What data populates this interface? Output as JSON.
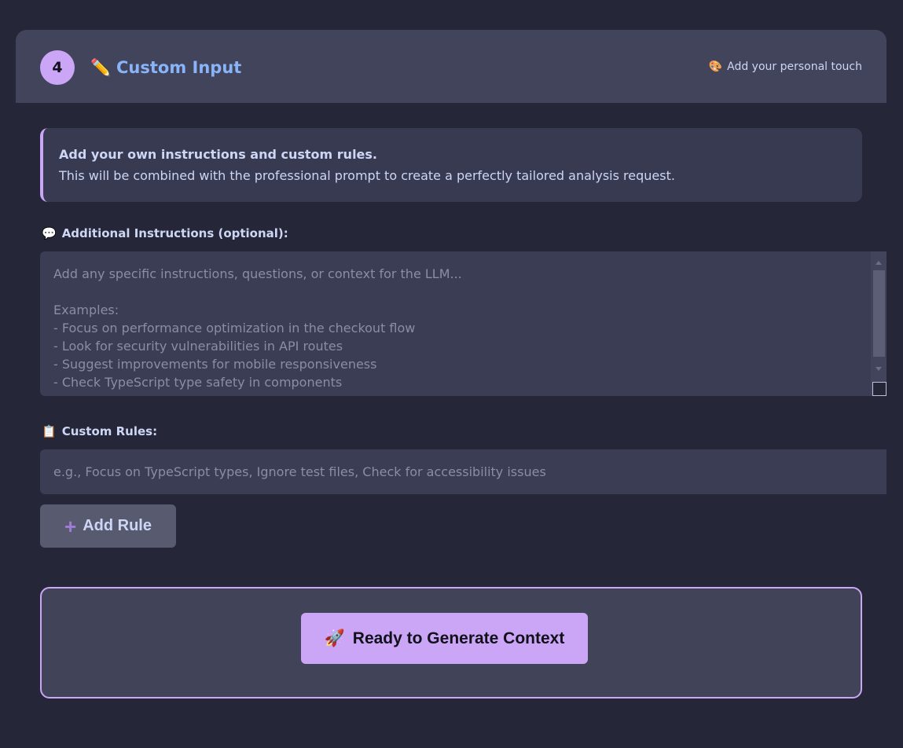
{
  "step": {
    "number": "4",
    "title_icon": "✏️",
    "title": "Custom Input",
    "hint_icon": "🎨",
    "hint": "Add your personal touch"
  },
  "info": {
    "strong": "Add your own instructions and custom rules.",
    "text": "This will be combined with the professional prompt to create a perfectly tailored analysis request."
  },
  "instructions": {
    "icon": "💬",
    "label": "Additional Instructions (optional):",
    "placeholder": "Add any specific instructions, questions, or context for the LLM...\n\nExamples:\n- Focus on performance optimization in the checkout flow\n- Look for security vulnerabilities in API routes\n- Suggest improvements for mobile responsiveness\n- Check TypeScript type safety in components",
    "value": ""
  },
  "rules": {
    "icon": "📋",
    "label": "Custom Rules:",
    "placeholder": "e.g., Focus on TypeScript types, Ignore test files, Check for accessibility issues",
    "value": "",
    "add_icon": "+",
    "add_label": "Add Rule"
  },
  "generate": {
    "icon": "🚀",
    "label": "Ready to Generate Context"
  },
  "colors": {
    "background": "#252739",
    "header": "#41445b",
    "accent": "#cba6f7",
    "title": "#89b4fa",
    "text": "#cdd6f4",
    "placeholder": "#8a8da3"
  },
  "icons": {
    "title": "pencil-icon",
    "hint": "palette-icon",
    "instructions": "speech-bubble-icon",
    "rules": "clipboard-icon",
    "add": "plus-icon",
    "generate": "rocket-icon"
  }
}
